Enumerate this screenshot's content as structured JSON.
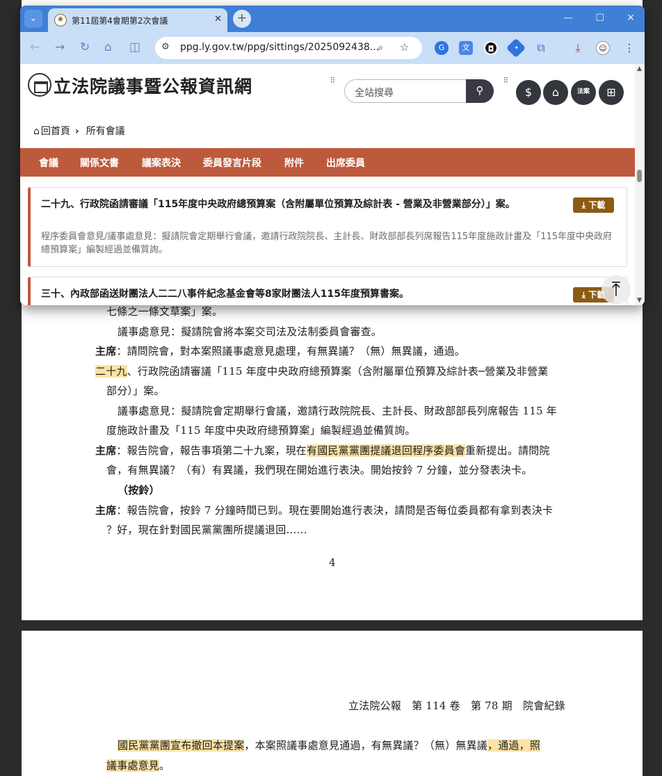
{
  "pdf": {
    "page_a_lines": [
      "七條之一條文草案」案。",
      "議事處意見：擬請院會將本案交司法及法制委員會審查。",
      "：請問院會，對本案照議事處意見處理，有無異議？（無）無異議，通過。",
      "、行政院函請審議「115 年度中央政府總預算案（含附屬單位預算及綜計表─營業及非營業",
      "部分）」案。",
      "議事處意見：擬請院會定期舉行會議，邀請行政院院長、主計長、財政部部長列席報告 115 年",
      "度施政計畫及「115 年度中央政府總預算案」編製經過並備質詢。",
      "：報告院會，報告事項第二十九案，現在",
      "重新提出。請問院",
      "會，有無異議？（有）有異議，我們現在開始進行表決。開始按鈴 7 分鐘，並分發表決卡。",
      "（按鈴）",
      "：報告院會，按鈴 7 分鐘時間已到。現在要開始進行表決，請問是否每位委員都有拿到表決卡",
      "？好，現在針對國民黨黨團所提議退回……"
    ],
    "speaker": "主席",
    "item_number_highlight": "二十九",
    "highlight_withdraw": "有國民黨黨團提議退回程序委員會",
    "page_number": "4",
    "page_b_header": "立法院公報　第 114 卷　第 78 期　院會紀錄",
    "page_b_highlight_1": "國民黨黨團宣布撤回本提案",
    "page_b_line1_rest": "，本案照議事處意見通過，有無異議？（無）無異議",
    "page_b_highlight_2": "，通過，照",
    "page_b_line2": "議事處意見",
    "page_b_line2_tail": "。"
  },
  "browser": {
    "tab_title": "第11屆第4會期第2次會議",
    "url": "ppg.ly.gov.tw/ppg/sittings/2025092438...",
    "window_controls": {
      "minimize": "—",
      "maximize": "☐",
      "close": "✕"
    }
  },
  "site": {
    "title": "立法院議事暨公報資訊網",
    "search_placeholder": "全站搜尋",
    "breadcrumb": {
      "home": "回首頁",
      "current": "所有會議"
    },
    "tabs": [
      "會議",
      "關係文書",
      "議案表決",
      "委員發言片段",
      "附件",
      "出席委員"
    ],
    "items": [
      {
        "title": "二十九、行政院函請審議「115年度中央政府總預算案（含附屬單位預算及綜計表 - 營業及非營業部分）」案。",
        "desc": "程序委員會意見/議事處意見：擬請院會定期舉行會議，邀請行政院院長、主計長、財政部部長列席報告115年度施政計畫及「115年度中央政府總預算案」編製經過並備質詢。",
        "download": "下載"
      },
      {
        "title": "三十、內政部函送財團法人二二八事件紀念基金會等8家財團法人115年度預算書案。",
        "download": "下載"
      }
    ],
    "legal_icon_text": "法案"
  },
  "colors": {
    "tab_strip": "#3f7fd6",
    "toolbar": "#c9def7",
    "nav_bar": "#be5a3c",
    "download_button": "#8b5a13",
    "highlight": "#fbe3a6"
  }
}
